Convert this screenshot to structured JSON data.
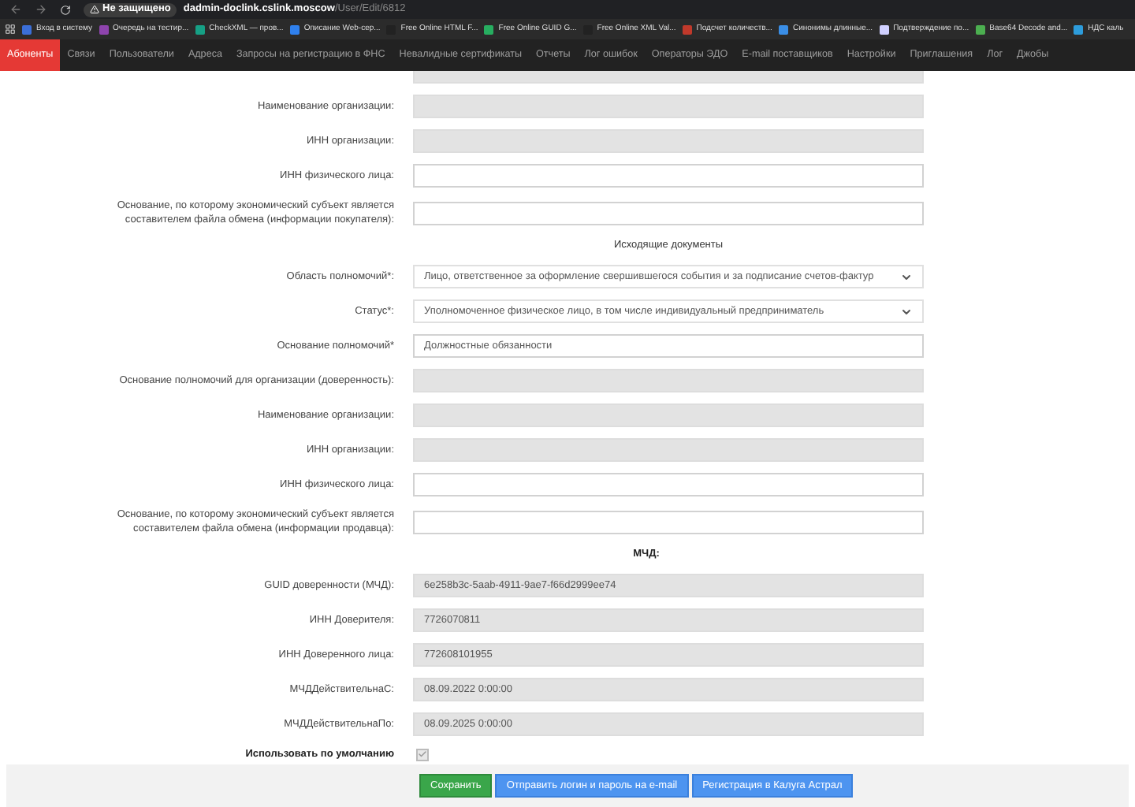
{
  "browser": {
    "security": "Не защищено",
    "url_host": "dadmin-doclink.cslink.moscow",
    "url_path": "/User/Edit/6812"
  },
  "bookmarks": [
    {
      "label": "Вход в систему",
      "color": "#3b6fd8"
    },
    {
      "label": "Очередь на тестир...",
      "color": "#8e44ad"
    },
    {
      "label": "CheckXML — пров...",
      "color": "#16a085"
    },
    {
      "label": "Описание Web-сер...",
      "color": "#2f80ed"
    },
    {
      "label": "Free Online HTML F...",
      "color": "#222222"
    },
    {
      "label": "Free Online GUID G...",
      "color": "#27ae60"
    },
    {
      "label": "Free Online XML Val...",
      "color": "#222222"
    },
    {
      "label": "Подсчет количеств...",
      "color": "#c0392b"
    },
    {
      "label": "Синонимы длинные...",
      "color": "#3a8ee6"
    },
    {
      "label": "Подтверждение по...",
      "color": "#d0d0ff"
    },
    {
      "label": "Base64 Decode and...",
      "color": "#4caf50"
    },
    {
      "label": "НДС каль",
      "color": "#2d9cdb"
    }
  ],
  "nav": [
    {
      "label": "Абоненты",
      "selected": true
    },
    {
      "label": "Связи",
      "selected": false
    },
    {
      "label": "Пользователи",
      "selected": false
    },
    {
      "label": "Адреса",
      "selected": false
    },
    {
      "label": "Запросы на регистрацию в ФНС",
      "selected": false
    },
    {
      "label": "Невалидные сертификаты",
      "selected": false
    },
    {
      "label": "Отчеты",
      "selected": false
    },
    {
      "label": "Лог ошибок",
      "selected": false
    },
    {
      "label": "Операторы ЭДО",
      "selected": false
    },
    {
      "label": "E-mail поставщиков",
      "selected": false
    },
    {
      "label": "Настройки",
      "selected": false
    },
    {
      "label": "Приглашения",
      "selected": false
    },
    {
      "label": "Лог",
      "selected": false
    },
    {
      "label": "Джобы",
      "selected": false
    }
  ],
  "form": [
    {
      "kind": "field",
      "disabled": true
    },
    {
      "kind": "field",
      "label": "Наименование организации:",
      "disabled": true
    },
    {
      "kind": "field",
      "label": "ИНН организации:",
      "disabled": true
    },
    {
      "kind": "field",
      "label": "ИНН физического лица:",
      "disabled": false
    },
    {
      "kind": "field",
      "label": "Основание, по которому экономический субъект является составителем файла обмена (информации покупателя):",
      "disabled": false
    },
    {
      "kind": "heading",
      "label": "Исходящие документы"
    },
    {
      "kind": "select",
      "label": "Область полномочий*:",
      "value": "Лицо, ответственное за оформление свершившегося события и за подписание счетов-фактур"
    },
    {
      "kind": "select",
      "label": "Статус*:",
      "value": "Уполномоченное физическое лицо, в том числе индивидуальный предприниматель"
    },
    {
      "kind": "field",
      "label": "Основание полномочий*",
      "value": "Должностные обязанности",
      "disabled": false
    },
    {
      "kind": "field",
      "label": "Основание полномочий для организации (доверенность):",
      "disabled": true
    },
    {
      "kind": "field",
      "label": "Наименование организации:",
      "disabled": true
    },
    {
      "kind": "field",
      "label": "ИНН организации:",
      "disabled": true
    },
    {
      "kind": "field",
      "label": "ИНН физического лица:",
      "disabled": false
    },
    {
      "kind": "field",
      "label": "Основание, по которому экономический субъект является составителем файла обмена (информации продавца):",
      "disabled": false
    },
    {
      "kind": "strong-heading",
      "label": "МЧД:"
    },
    {
      "kind": "field",
      "label": "GUID доверенности (МЧД):",
      "value": "6e258b3c-5aab-4911-9ae7-f66d2999ee74",
      "disabled": true
    },
    {
      "kind": "field",
      "label": "ИНН Доверителя:",
      "value": "7726070811",
      "disabled": true
    },
    {
      "kind": "field",
      "label": "ИНН Доверенного лица:",
      "value": "772608101955",
      "disabled": true
    },
    {
      "kind": "field",
      "label": "МЧДДействительнаС:",
      "value": "08.09.2022 0:00:00",
      "disabled": true
    },
    {
      "kind": "field",
      "label": "МЧДДействительнаПо:",
      "value": "08.09.2025 0:00:00",
      "disabled": true
    },
    {
      "kind": "checkbox",
      "label": "Использовать по умолчанию",
      "checked": true
    }
  ],
  "buttons": [
    {
      "label": "Сохранить",
      "kind": "primary"
    },
    {
      "label": "Отправить логин и пароль на e-mail",
      "kind": "secondary"
    },
    {
      "label": "Регистрация в Калуга Астрал",
      "kind": "secondary"
    }
  ]
}
